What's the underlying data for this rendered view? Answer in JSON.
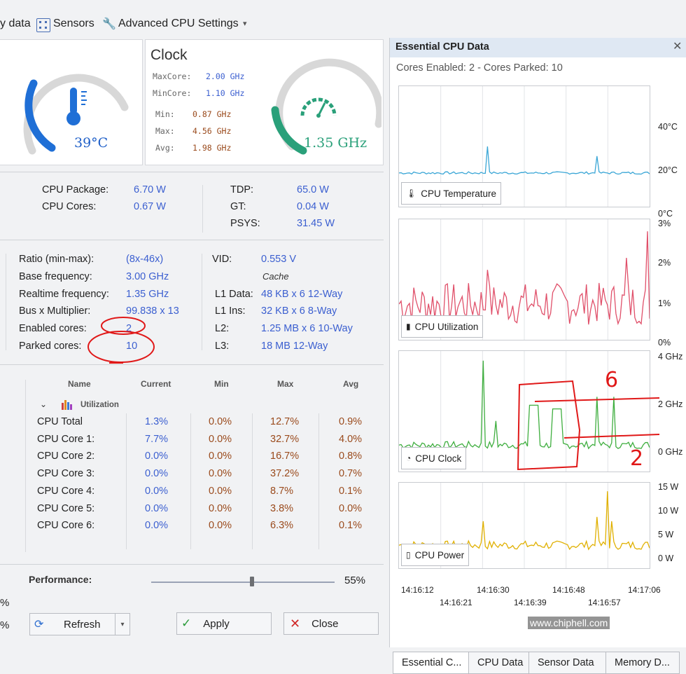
{
  "toolbar": {
    "items": [
      {
        "label": "y data"
      },
      {
        "label": "Sensors"
      },
      {
        "label": "Advanced CPU Settings"
      }
    ]
  },
  "temperature_gauge": {
    "value": "39°C",
    "color": "#1f6fd6"
  },
  "clock": {
    "title": "Clock",
    "rows": [
      {
        "label": "MaxCore:",
        "value": "2.00 GHz"
      },
      {
        "label": "MinCore:",
        "value": "1.10 GHz"
      },
      {
        "label": "Min:",
        "value": "0.87 GHz"
      },
      {
        "label": "Max:",
        "value": "4.56 GHz"
      },
      {
        "label": "Avg:",
        "value": "1.98 GHz"
      }
    ],
    "gauge_value": "1.35 GHz",
    "gauge_color": "#2aa07a"
  },
  "power": {
    "left": [
      {
        "label": "CPU Package:",
        "value": "6.70 W"
      },
      {
        "label": "CPU Cores:",
        "value": "0.67 W"
      }
    ],
    "right": [
      {
        "label": "TDP:",
        "value": "65.0 W"
      },
      {
        "label": "GT:",
        "value": "0.04 W"
      },
      {
        "label": "PSYS:",
        "value": "31.45 W"
      }
    ]
  },
  "details": {
    "left": [
      {
        "label": "Ratio (min-max):",
        "value": "(8x-46x)"
      },
      {
        "label": "Base frequency:",
        "value": "3.00 GHz"
      },
      {
        "label": "Realtime frequency:",
        "value": "1.35 GHz"
      },
      {
        "label": "Bus x Multiplier:",
        "value": "99.838 x 13"
      },
      {
        "label": "Enabled cores:",
        "value": "2"
      },
      {
        "label": "Parked cores:",
        "value": "10"
      }
    ],
    "vid_label": "VID:",
    "vid_value": "0.553 V",
    "cache_title": "Cache",
    "cache": [
      {
        "label": "L1 Data:",
        "value": "48 KB x 6  12-Way"
      },
      {
        "label": "L1 Ins:",
        "value": "32 KB x 6  8-Way"
      },
      {
        "label": "L2:",
        "value": "1.25 MB x 6  10-Way"
      },
      {
        "label": "L3:",
        "value": "18 MB  12-Way"
      }
    ]
  },
  "table": {
    "headers": [
      "Name",
      "Current",
      "Min",
      "Max",
      "Avg"
    ],
    "group": "Utilization",
    "rows": [
      [
        "CPU Total",
        "1.3%",
        "0.0%",
        "12.7%",
        "0.9%"
      ],
      [
        "CPU Core 1:",
        "7.7%",
        "0.0%",
        "32.7%",
        "4.0%"
      ],
      [
        "CPU Core 2:",
        "0.0%",
        "0.0%",
        "16.7%",
        "0.8%"
      ],
      [
        "CPU Core 3:",
        "0.0%",
        "0.0%",
        "37.2%",
        "0.7%"
      ],
      [
        "CPU Core 4:",
        "0.0%",
        "0.0%",
        "8.7%",
        "0.1%"
      ],
      [
        "CPU Core 5:",
        "0.0%",
        "0.0%",
        "3.8%",
        "0.0%"
      ],
      [
        "CPU Core 6:",
        "0.0%",
        "0.0%",
        "6.3%",
        "0.1%"
      ]
    ]
  },
  "performance": {
    "label": "Performance:",
    "value": "55%",
    "level": 0.55,
    "left_pct_a": "%",
    "left_pct_b": "%"
  },
  "buttons": {
    "refresh": "Refresh",
    "apply": "Apply",
    "close": "Close"
  },
  "panel": {
    "title": "Essential CPU Data",
    "status": "Cores Enabled: 2 - Cores Parked: 10",
    "charts": [
      {
        "label": "CPU Temperature",
        "axis": [
          "40°C",
          "20°C",
          "0°C"
        ],
        "color": "#3aa6d6"
      },
      {
        "label": "CPU Utilization",
        "axis": [
          "3%",
          "2%",
          "1%",
          "0%"
        ],
        "color": "#e0506a"
      },
      {
        "label": "CPU Clock",
        "axis": [
          "4 GHz",
          "2 GHz",
          "0 GHz"
        ],
        "color": "#3fae3f"
      },
      {
        "label": "CPU Power",
        "axis": [
          "15 W",
          "10 W",
          "5 W",
          "0 W"
        ],
        "color": "#e0b000"
      }
    ],
    "times_top": [
      "14:16:12",
      "14:16:30",
      "14:16:48",
      "14:17:06"
    ],
    "times_bottom": [
      "14:16:21",
      "14:16:39",
      "14:16:57"
    ],
    "tabs": [
      "Essential C...",
      "CPU Data",
      "Sensor Data",
      "Memory D..."
    ]
  },
  "watermark": "www.chiphell.com",
  "annotations": {
    "six": "6",
    "two": "2"
  }
}
